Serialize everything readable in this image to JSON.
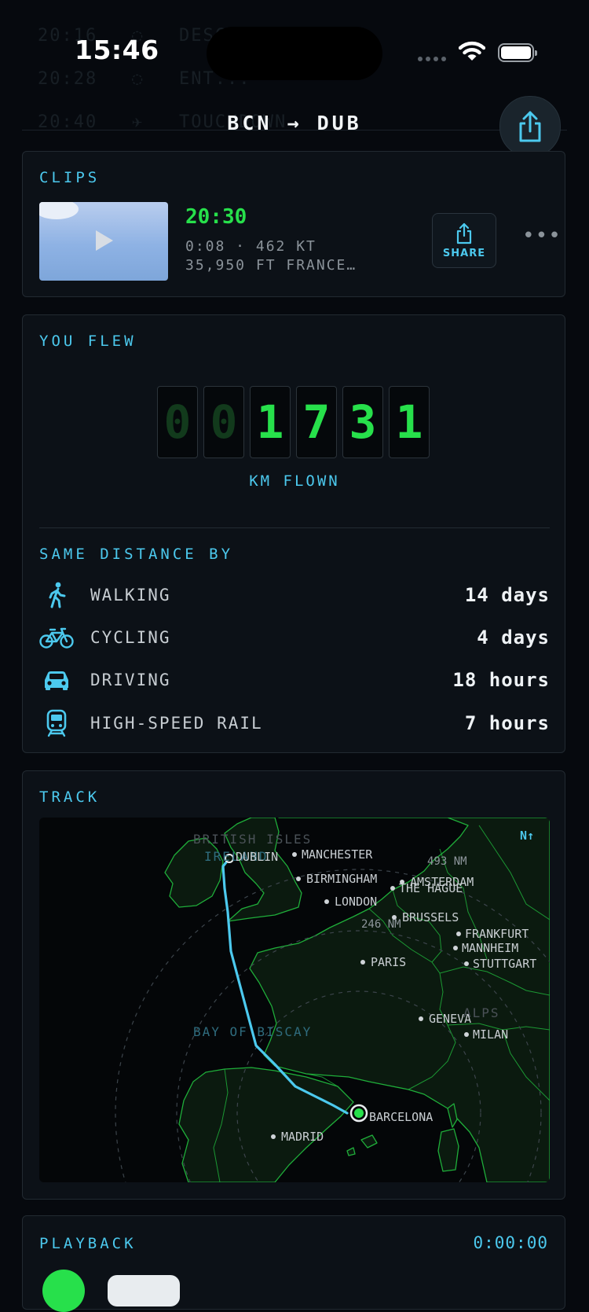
{
  "status": {
    "time": "15:46"
  },
  "background_rows": [
    {
      "time": "20:16",
      "event": "DESCENT BEGINS"
    },
    {
      "time": "20:28",
      "event": "ENT..."
    },
    {
      "time": "20:40",
      "event": "TOUCHDOWN"
    }
  ],
  "header": {
    "route": "BCN → DUB"
  },
  "clips": {
    "label": "CLIPS",
    "time": "20:30",
    "meta_line1": "0:08 · 462 KT",
    "meta_line2": "35,950 FT   FRANCE…",
    "share_label": "SHARE"
  },
  "flew": {
    "label": "YOU FLEW",
    "digits": [
      "0",
      "0",
      "1",
      "7",
      "3",
      "1"
    ],
    "unit_label": "KM FLOWN",
    "same_label": "SAME DISTANCE BY",
    "modes": [
      {
        "name": "WALKING",
        "value": "14 days",
        "icon": "walking-icon"
      },
      {
        "name": "CYCLING",
        "value": "4 days",
        "icon": "bicycle-icon"
      },
      {
        "name": "DRIVING",
        "value": "18 hours",
        "icon": "car-icon"
      },
      {
        "name": "HIGH-SPEED RAIL",
        "value": "7 hours",
        "icon": "train-icon"
      }
    ]
  },
  "track": {
    "label": "TRACK",
    "north": "N↑",
    "regions": [
      "BRITISH ISLES",
      "IRELAND",
      "BAY OF BISCAY",
      "ALPS"
    ],
    "ring_labels": [
      "493 NM",
      "246 NM"
    ],
    "cities": [
      "DUBLIN",
      "MANCHESTER",
      "BIRMINGHAM",
      "LONDON",
      "AMSTERDAM",
      "THE HAGUE",
      "BRUSSELS",
      "FRANKFURT",
      "MANNHEIM",
      "STUTTGART",
      "PARIS",
      "GENEVA",
      "MILAN",
      "BARCELONA",
      "MADRID"
    ]
  },
  "playback": {
    "label": "PLAYBACK",
    "time": "0:00:00"
  },
  "colors": {
    "accent": "#4cc9ee",
    "green": "#27e04b",
    "background": "#06090e",
    "card": "#0c1117"
  }
}
